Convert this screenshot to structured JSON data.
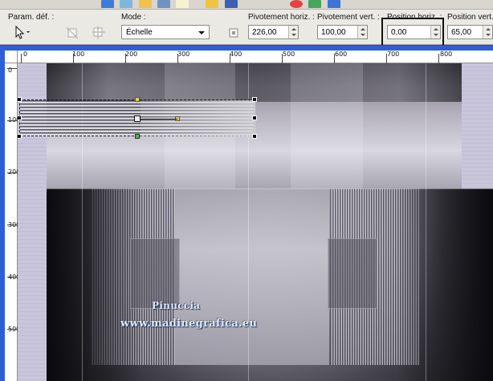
{
  "toolbar": {
    "preset_label": "Param. déf. :",
    "mode_label": "Mode :",
    "mode_value": "Échelle",
    "pivot_h_label": "Pivotement horiz. :",
    "pivot_h_value": "226,00",
    "pivot_v_label": "Pivotement vert. :",
    "pivot_v_value": "100,00",
    "pos_h_label": "Position horiz. :",
    "pos_h_value": "0,00",
    "pos_v_label": "Position vert. :",
    "pos_v_value": "65,00"
  },
  "rulers": {
    "top": [
      "0",
      "100",
      "200",
      "300",
      "400",
      "500",
      "600",
      "700",
      "800"
    ],
    "left": [
      "0",
      "100",
      "200",
      "300",
      "400",
      "500"
    ]
  },
  "watermark": {
    "line1": "Pinuccia",
    "line2": "www.madinegrafica.eu"
  },
  "icons": {
    "pointer": "arrow-cursor-icon",
    "tools": [
      "transform-icon",
      "crop-icon",
      "align-icon"
    ]
  },
  "colors": {
    "window_blue": "#2d5fd8",
    "highlight": "#111111"
  }
}
